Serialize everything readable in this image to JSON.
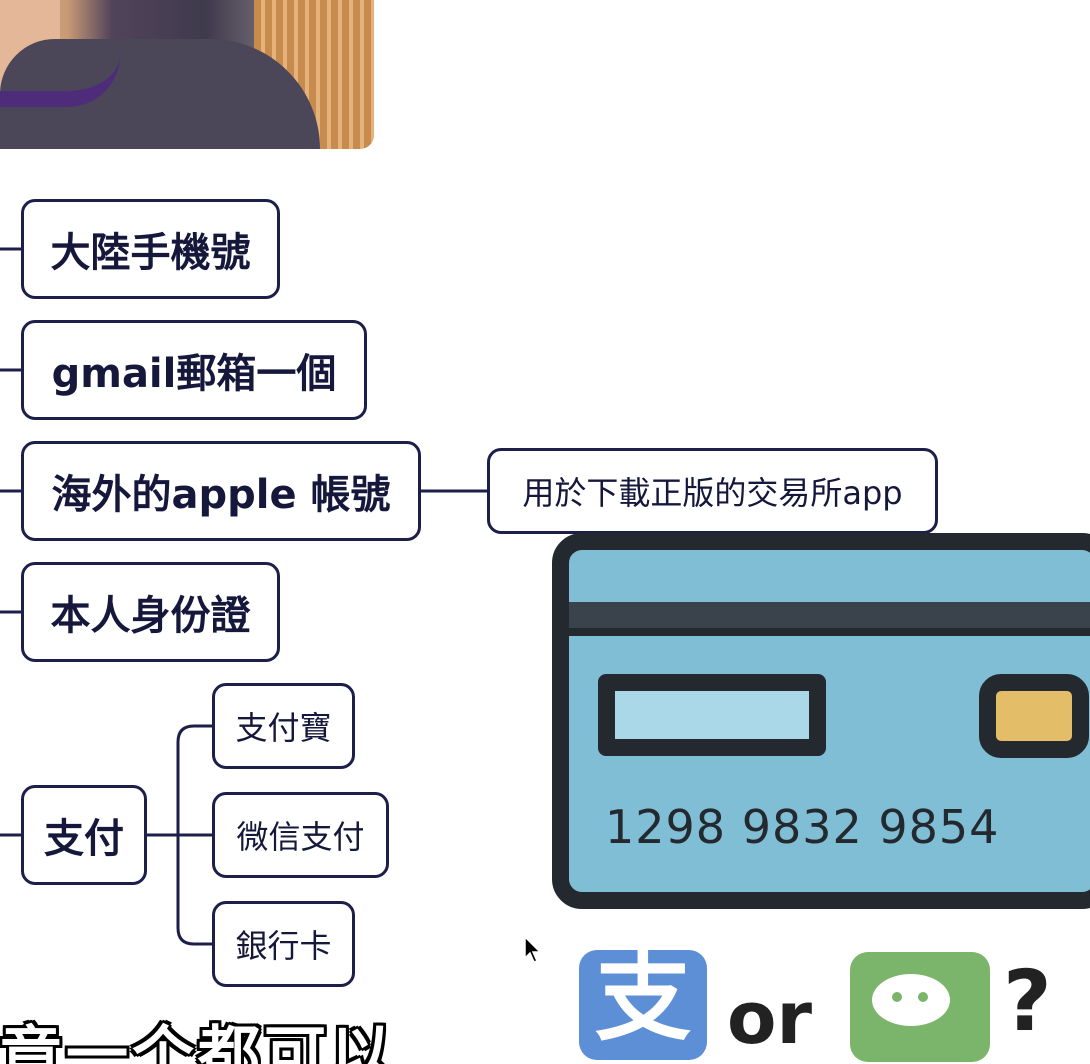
{
  "mindmap": {
    "items": [
      {
        "label": "大陸手機號"
      },
      {
        "label": "gmail郵箱一個"
      },
      {
        "label": "海外的apple 帳號",
        "child": "用於下載正版的交易所app"
      },
      {
        "label": "本人身份證"
      },
      {
        "label": "支付",
        "children": [
          "支付寶",
          "微信支付",
          "銀行卡"
        ]
      }
    ]
  },
  "card": {
    "number": "1298 9832 9854",
    "colors": {
      "body": "#7fbed4",
      "outline": "#23292f",
      "chip": "#e3bd68"
    }
  },
  "payment_options": {
    "alipay_glyph": "支",
    "or_text": "or",
    "question": "?"
  },
  "subtitle": "竟一个都可以",
  "icons": [
    "alipay-icon",
    "wechat-icon",
    "credit-card-icon",
    "mouse-cursor-icon"
  ]
}
